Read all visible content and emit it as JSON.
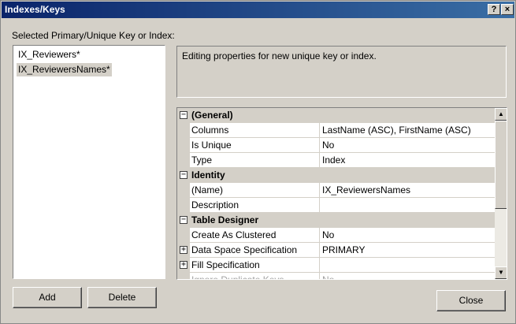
{
  "window": {
    "title": "Indexes/Keys",
    "help_label": "?",
    "close_label": "×"
  },
  "list_section": {
    "label": "Selected Primary/Unique Key or Index:",
    "items": [
      "IX_Reviewers*",
      "IX_ReviewersNames*"
    ],
    "selected_index": 1
  },
  "description": "Editing properties for new unique key or index.",
  "properties": {
    "rows": [
      {
        "kind": "category",
        "name": "(General)",
        "expander": "−"
      },
      {
        "kind": "prop",
        "name": "Columns",
        "value": "LastName (ASC), FirstName (ASC)"
      },
      {
        "kind": "prop",
        "name": "Is Unique",
        "value": "No"
      },
      {
        "kind": "prop",
        "name": "Type",
        "value": "Index"
      },
      {
        "kind": "category",
        "name": "Identity",
        "expander": "−"
      },
      {
        "kind": "prop",
        "name": "(Name)",
        "value": "IX_ReviewersNames"
      },
      {
        "kind": "prop",
        "name": "Description",
        "value": ""
      },
      {
        "kind": "category",
        "name": "Table Designer",
        "expander": "−"
      },
      {
        "kind": "prop",
        "name": "Create As Clustered",
        "value": "No"
      },
      {
        "kind": "prop",
        "name": "Data Space Specification",
        "value": "PRIMARY",
        "expander": "+"
      },
      {
        "kind": "prop",
        "name": "Fill Specification",
        "value": "",
        "expander": "+"
      },
      {
        "kind": "prop",
        "name": "Ignore Duplicate Keys",
        "value": "No",
        "faded": true
      }
    ]
  },
  "buttons": {
    "add": "Add",
    "delete": "Delete",
    "close": "Close"
  },
  "scroll_arrows": {
    "up": "▲",
    "down": "▼"
  }
}
